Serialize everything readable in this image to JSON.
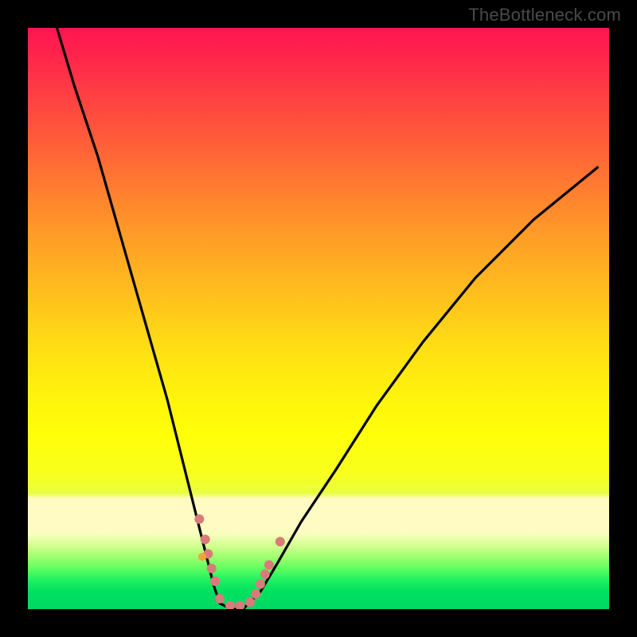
{
  "watermark": "TheBottleneck.com",
  "chart_data": {
    "type": "line",
    "title": "",
    "xlabel": "",
    "ylabel": "",
    "xlim": [
      0,
      100
    ],
    "ylim": [
      0,
      100
    ],
    "series": [
      {
        "name": "bottleneck-curve",
        "x": [
          5,
          8,
          12,
          16,
          20,
          24,
          27,
          29,
          30,
          31,
          32,
          33,
          35,
          37,
          38,
          40,
          43,
          47,
          53,
          60,
          68,
          77,
          87,
          98
        ],
        "values": [
          100,
          90,
          78,
          64,
          50,
          36,
          24,
          16,
          12,
          8,
          4,
          1,
          0,
          0,
          1,
          3,
          8,
          15,
          24,
          35,
          46,
          57,
          67,
          76
        ]
      }
    ],
    "markers": [
      {
        "name": "left-cluster-1",
        "x": 29.5,
        "y": 15.5,
        "color": "#d97b7b",
        "size": 12
      },
      {
        "name": "left-cluster-2",
        "x": 30.5,
        "y": 12.0,
        "color": "#d97b7b",
        "size": 12
      },
      {
        "name": "left-cluster-3",
        "x": 31.0,
        "y": 9.5,
        "color": "#d97b7b",
        "size": 12
      },
      {
        "name": "left-cluster-3b",
        "x": 30.0,
        "y": 9.0,
        "color": "#f2a23a",
        "size": 10
      },
      {
        "name": "left-cluster-4",
        "x": 31.6,
        "y": 7.0,
        "color": "#d97b7b",
        "size": 12
      },
      {
        "name": "left-cluster-5",
        "x": 32.2,
        "y": 4.8,
        "color": "#d97b7b",
        "size": 12
      },
      {
        "name": "bottom-1",
        "x": 33.0,
        "y": 1.8,
        "color": "#d97b7b",
        "size": 12
      },
      {
        "name": "bottom-2",
        "x": 34.8,
        "y": 0.6,
        "color": "#d97b7b",
        "size": 12
      },
      {
        "name": "bottom-3",
        "x": 36.5,
        "y": 0.6,
        "color": "#d97b7b",
        "size": 12
      },
      {
        "name": "bottom-4",
        "x": 38.2,
        "y": 1.2,
        "color": "#d97b7b",
        "size": 12
      },
      {
        "name": "right-cluster-1",
        "x": 39.2,
        "y": 2.6,
        "color": "#d97b7b",
        "size": 12
      },
      {
        "name": "right-cluster-2",
        "x": 40.0,
        "y": 4.3,
        "color": "#d97b7b",
        "size": 12
      },
      {
        "name": "right-cluster-3",
        "x": 40.8,
        "y": 6.0,
        "color": "#d97b7b",
        "size": 12
      },
      {
        "name": "right-cluster-4",
        "x": 41.5,
        "y": 7.6,
        "color": "#d97b7b",
        "size": 12
      },
      {
        "name": "right-outlier",
        "x": 43.4,
        "y": 11.6,
        "color": "#d97b7b",
        "size": 12
      }
    ],
    "colors": {
      "curve": "#000000",
      "marker_primary": "#d97b7b",
      "marker_secondary": "#f2a23a"
    }
  }
}
